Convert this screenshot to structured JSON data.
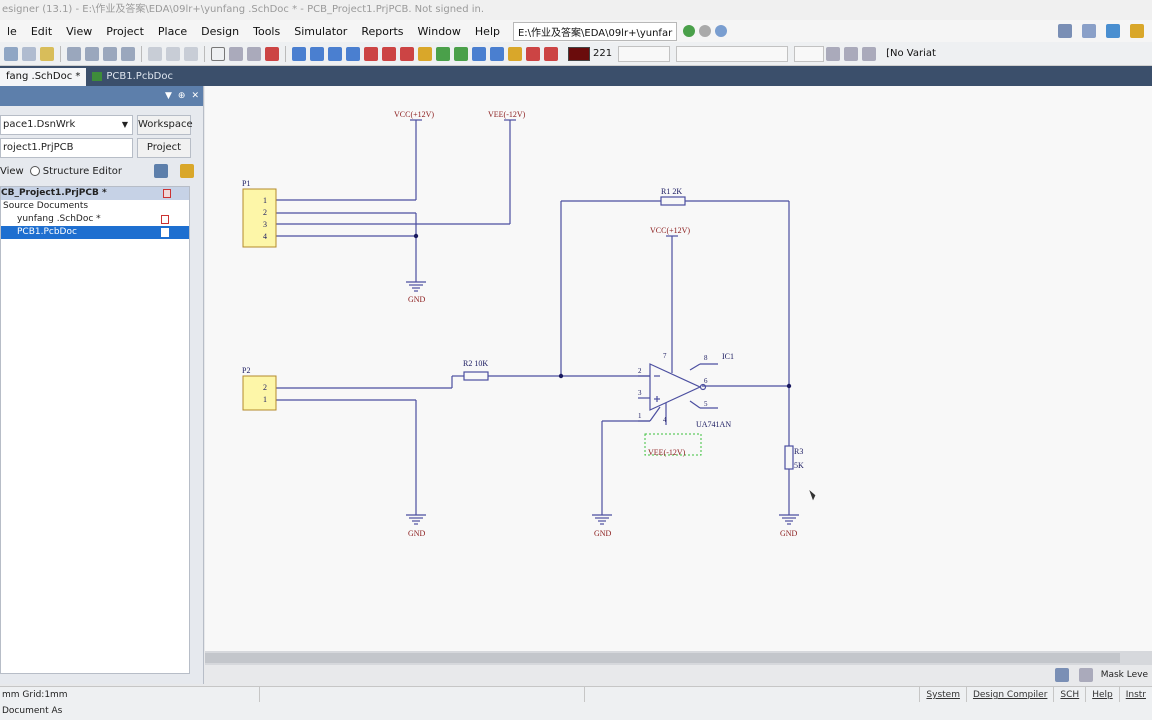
{
  "window": {
    "title": "esigner (13.1) - E:\\作业及答案\\EDA\\09lr+\\yunfang .SchDoc * - PCB_Project1.PrjPCB. Not signed in."
  },
  "menu": {
    "items": [
      "le",
      "Edit",
      "View",
      "Project",
      "Place",
      "Design",
      "Tools",
      "Simulator",
      "Reports",
      "Window",
      "Help"
    ],
    "path": "E:\\作业及答案\\EDA\\09lr+\\yunfar"
  },
  "toolbar": {
    "color_value": "221",
    "variant": "[No Variat"
  },
  "tabs": [
    {
      "label": "fang .SchDoc *",
      "active": true
    },
    {
      "label": "PCB1.PcbDoc",
      "active": false
    }
  ],
  "panel": {
    "workspace_value": "pace1.DsnWrk",
    "workspace_button": "Workspace",
    "project_value": "roject1.PrjPCB",
    "project_button": "Project",
    "view_label": "View",
    "structure_label": "Structure Editor",
    "tree": {
      "project": "CB_Project1.PrjPCB *",
      "folder": "Source Documents",
      "doc1": "yunfang .SchDoc *",
      "doc2": "PCB1.PcbDoc"
    }
  },
  "schematic": {
    "vcc": "VCC(+12V)",
    "vee": "VEE(-12V)",
    "gnd": "GND",
    "p1": {
      "label": "P1",
      "pins": [
        "1",
        "2",
        "3",
        "4"
      ]
    },
    "p2": {
      "label": "P2",
      "pins": [
        "2",
        "1"
      ]
    },
    "r1": "R1  2K",
    "r2": "R2  10K",
    "r3_name": "R3",
    "r3_value": "5K",
    "ic": {
      "ref": "IC1",
      "part": "UA741AN",
      "pins": [
        "2",
        "3",
        "1",
        "7",
        "8",
        "6",
        "5",
        "4"
      ]
    }
  },
  "mask": {
    "label": "Mask Leve"
  },
  "status": {
    "grid": "mm   Grid:1mm",
    "buttons": [
      "System",
      "Design Compiler",
      "SCH",
      "Help",
      "Instr"
    ],
    "bottom": "Document As"
  }
}
